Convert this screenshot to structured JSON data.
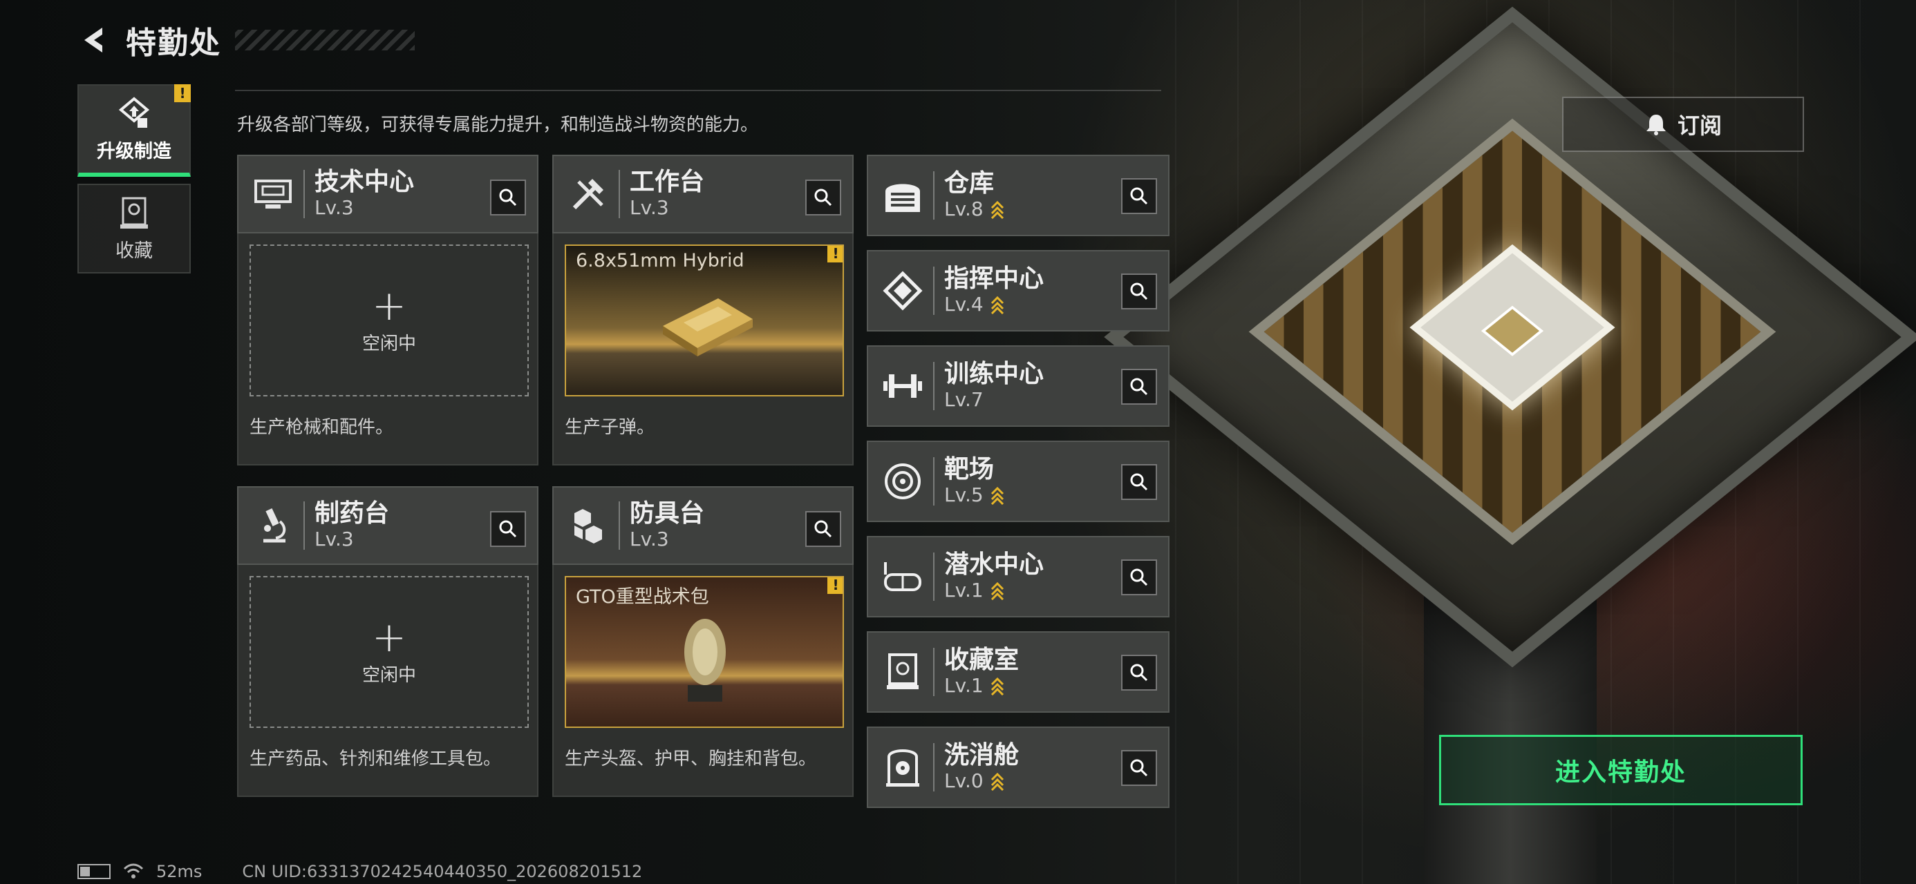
{
  "header": {
    "title": "特勤处"
  },
  "nav": {
    "items": [
      {
        "label": "升级制造",
        "active": true,
        "badge": "!"
      },
      {
        "label": "收藏",
        "active": false
      }
    ]
  },
  "description": "升级各部门等级，可获得专属能力提升，和制造战斗物资的能力。",
  "subscribe": {
    "label": "订阅"
  },
  "cards": [
    {
      "name": "技术中心",
      "level": "Lv.3",
      "state": "idle",
      "slot_text": "空闲中",
      "plus": "+",
      "desc": "生产枪械和配件。",
      "icon": "monitor-icon"
    },
    {
      "name": "工作台",
      "level": "Lv.3",
      "state": "producing",
      "item": "6.8x51mm Hybrid",
      "badge": "!",
      "desc": "生产子弹。",
      "icon": "tools-icon"
    },
    {
      "name": "制药台",
      "level": "Lv.3",
      "state": "idle",
      "slot_text": "空闲中",
      "plus": "+",
      "desc": "生产药品、针剂和维修工具包。",
      "icon": "microscope-icon"
    },
    {
      "name": "防具台",
      "level": "Lv.3",
      "state": "producing",
      "item": "GTO重型战术包",
      "badge": "!",
      "desc": "生产头盔、护甲、胸挂和背包。",
      "icon": "cubes-icon"
    }
  ],
  "facilities": [
    {
      "name": "仓库",
      "level": "Lv.8",
      "upgradable": true,
      "icon": "warehouse-icon"
    },
    {
      "name": "指挥中心",
      "level": "Lv.4",
      "upgradable": true,
      "icon": "chip-icon"
    },
    {
      "name": "训练中心",
      "level": "Lv.7",
      "upgradable": false,
      "icon": "dumbbell-icon"
    },
    {
      "name": "靶场",
      "level": "Lv.5",
      "upgradable": true,
      "icon": "target-icon"
    },
    {
      "name": "潜水中心",
      "level": "Lv.1",
      "upgradable": true,
      "icon": "goggles-icon"
    },
    {
      "name": "收藏室",
      "level": "Lv.1",
      "upgradable": true,
      "icon": "display-case-icon"
    },
    {
      "name": "洗消舱",
      "level": "Lv.0",
      "upgradable": true,
      "icon": "decon-icon"
    }
  ],
  "enter_button": {
    "label": "进入特勤处"
  },
  "status": {
    "ping": "52ms",
    "uid": "CN UID:6331370242540440350_202608201512"
  },
  "colors": {
    "accent": "#2fe07a",
    "alert": "#e7b628",
    "upgrade_chevron": "#e7b628"
  }
}
